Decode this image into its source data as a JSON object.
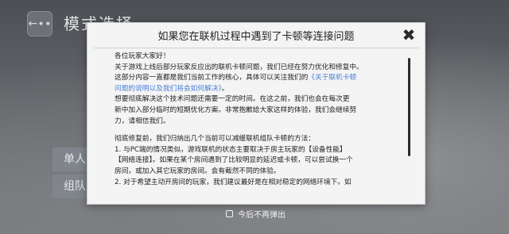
{
  "background": {
    "back_icon": "←∙∙",
    "title": "模式选择",
    "button_1": "单人",
    "button_2": "组队"
  },
  "dialog": {
    "title": "如果您在联机过程中遇到了卡顿等连接问题",
    "close_icon": "✖",
    "paragraph_1": {
      "l1": "各位玩家大家好！",
      "l2": "关于游戏上线后部分玩家反应出的联机卡顿问题，我们已经在努力优化和修复中。",
      "l3_pre": "这部分内容一直都是我们当前工作的核心，具体可以关注我们的",
      "l3_link": "《关于联机卡顿",
      "l4_link": "问题的说明以及我们将会如何解决》",
      "l4_post": "。",
      "l5": "想要彻底解决这个技术问题还需要一定的时间。在这之前，我们也会在每次更",
      "l6": "新中加入部分临时的短期优化方案。非常抱歉给大家这样的体验，我们会继续努",
      "l7": "力，请相信我们。"
    },
    "paragraph_2": {
      "l1": "彻底修复前，我们归纳出几个当前可以减缓联机组队卡顿的方法：",
      "l2": "1. 与PC端的情况类似，游戏联机的状态主要取决于房主玩家的【设备性能】",
      "l3": "【网络连接】。如果在某个房间遇到了比较明显的延迟或卡顿，可以尝试换一个",
      "l4": "房间，或加入其它玩家的房间。会有截然不同的体验。",
      "l5": "2. 对于希望主动开房间的玩家，我们建议最好是在相对稳定的网络环境下。如"
    },
    "dont_show_label": "今后不再弹出"
  }
}
